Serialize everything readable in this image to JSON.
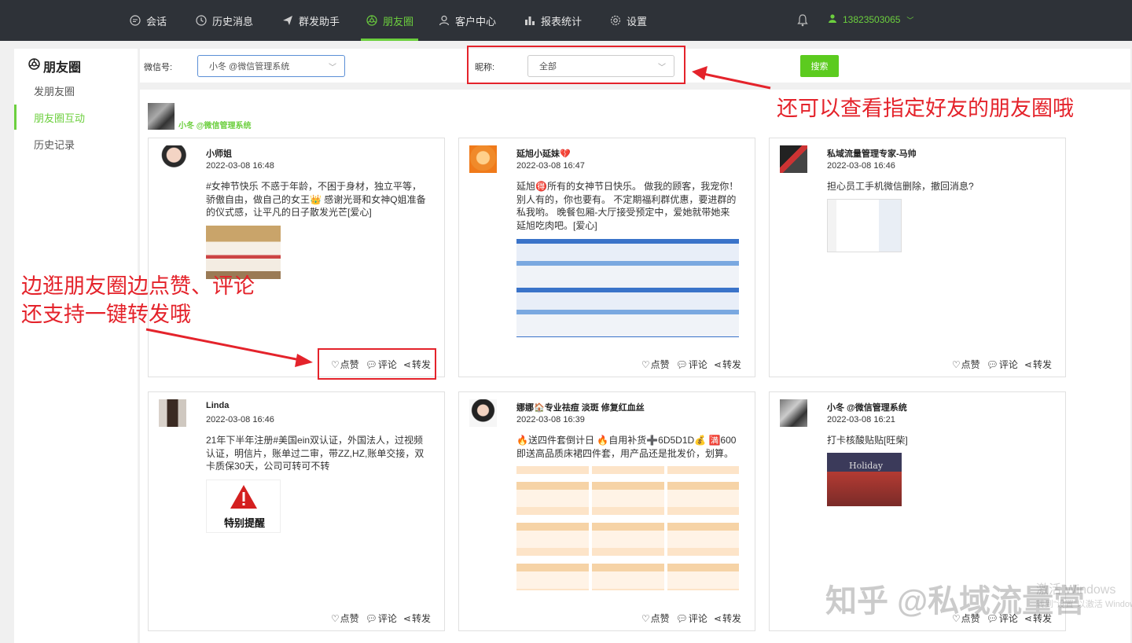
{
  "nav": {
    "items": [
      {
        "label": "会话",
        "icon": "chat-icon"
      },
      {
        "label": "历史消息",
        "icon": "clock-icon"
      },
      {
        "label": "群发助手",
        "icon": "send-icon"
      },
      {
        "label": "朋友圈",
        "icon": "moments-icon",
        "active": true
      },
      {
        "label": "客户中心",
        "icon": "user-icon"
      },
      {
        "label": "报表统计",
        "icon": "bar-chart-icon"
      },
      {
        "label": "设置",
        "icon": "gear-icon"
      }
    ],
    "user_phone": "13823503065"
  },
  "sidebar": {
    "title": "朋友圈",
    "items": [
      {
        "label": "发朋友圈"
      },
      {
        "label": "朋友圈互动",
        "active": true
      },
      {
        "label": "历史记录"
      }
    ]
  },
  "filter": {
    "wechat_label": "微信号:",
    "wechat_value": "小冬  @微信管理系统",
    "nickname_label": "昵称:",
    "nickname_value": "全部",
    "search_label": "搜索"
  },
  "account": {
    "name": "小冬 @微信管理系统"
  },
  "posts": [
    {
      "name": "小师姐",
      "time": "2022-03-08 16:48",
      "text": "#女神节快乐 不惑于年龄，不困于身材，独立平等，骄傲自由，做自己的女王👑 感谢光哥和女神Q姐准备的仪式感，让平凡的日子散发光芒[爱心]"
    },
    {
      "name": "延旭小延妹💔",
      "time": "2022-03-08 16:47",
      "text": "延旭🉐所有的女神节日快乐。 做我的顾客，我宠你！别人有的，你也要有。 不定期福利群优惠，要进群的私我哟。 晚餐包厢-大厅接受预定中，爱她就带她来延旭吃肉吧。[爱心]"
    },
    {
      "name": "私域流量管理专家-马帅",
      "time": "2022-03-08 16:46",
      "text": "担心员工手机微信删除，撤回消息?"
    },
    {
      "name": "Linda",
      "time": "2022-03-08 16:46",
      "text": "21年下半年注册#美国ein双认证，外国法人，过视频认证，明信片，账单过二审，带ZZ,HZ,账单交接，双卡质保30天，公司可转可不转"
    },
    {
      "name": "娜娜🏠专业祛痘 淡斑 修复红血丝",
      "time": "2022-03-08 16:39",
      "text": "🔥送四件套倒计日 🔥自用补货➕6D5D1D💰 🈵600即送高品质床裙四件套，用产品还是批发价，划算。"
    },
    {
      "name": "小冬 @微信管理系统",
      "time": "2022-03-08 16:21",
      "text": "打卡核酸贴贴[旺柴]"
    }
  ],
  "actions": {
    "like": "点赞",
    "comment": "评论",
    "share": "转发"
  },
  "images": {
    "warning_text": "特别提醒",
    "holiday_text": "Holiday"
  },
  "annotations": {
    "right_note": "还可以查看指定好友的朋友圈哦",
    "left_note_line1": "边逛朋友圈边点赞、评论",
    "left_note_line2": "还支持一键转发哦"
  },
  "watermark": {
    "text": "知乎 @私域流量营",
    "windows_text": "激活 Windows",
    "windows_sub": "转到\"设置\"以激活 Windows。"
  },
  "colors": {
    "accent": "#6ccf3e",
    "nav_bg": "#2e3238",
    "annotation": "#e4232b",
    "search_button": "#5ccb1f"
  }
}
